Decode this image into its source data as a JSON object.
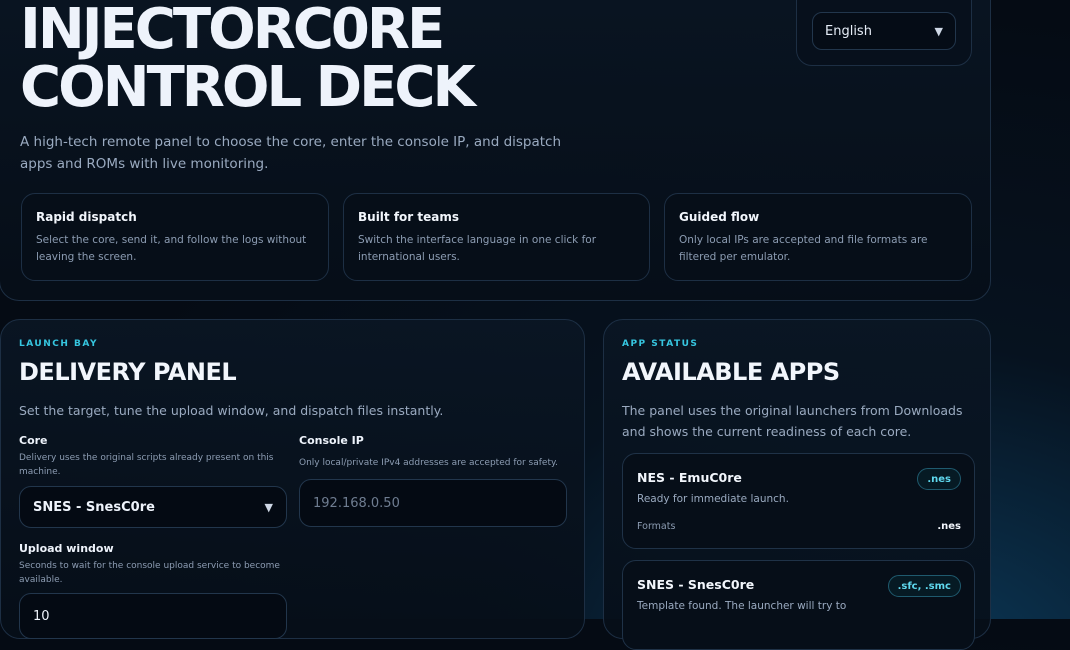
{
  "hero": {
    "title_line1": "INJECTORC0RE",
    "title_line2": "CONTROL DECK",
    "subtitle": "A high-tech remote panel to choose the core, enter the console IP, and dispatch apps and ROMs with live monitoring.",
    "language": "English",
    "features": [
      {
        "title": "Rapid dispatch",
        "desc": "Select the core, send it, and follow the logs without leaving the screen."
      },
      {
        "title": "Built for teams",
        "desc": "Switch the interface language in one click for international users."
      },
      {
        "title": "Guided flow",
        "desc": "Only local IPs are accepted and file formats are filtered per emulator."
      }
    ]
  },
  "delivery": {
    "eyebrow": "LAUNCH BAY",
    "title": "DELIVERY PANEL",
    "subtitle": "Set the target, tune the upload window, and dispatch files instantly.",
    "core_label": "Core",
    "core_help": "Delivery uses the original scripts already present on this machine.",
    "core_value": "SNES - SnesC0re",
    "ip_label": "Console IP",
    "ip_help": "Only local/private IPv4 addresses are accepted for safety.",
    "ip_placeholder": "192.168.0.50",
    "upload_label": "Upload window",
    "upload_help": "Seconds to wait for the console upload service to become available.",
    "upload_value": "10"
  },
  "apps": {
    "eyebrow": "APP STATUS",
    "title": "AVAILABLE APPS",
    "subtitle": "The panel uses the original launchers from Downloads and shows the current readiness of each core.",
    "items": [
      {
        "name": "NES - EmuC0re",
        "status": "Ready for immediate launch.",
        "badge": ".nes",
        "formats_label": "Formats",
        "formats": ".nes"
      },
      {
        "name": "SNES - SnesC0re",
        "status": "Template found. The launcher will try to",
        "badge": ".sfc, .smc"
      }
    ]
  }
}
